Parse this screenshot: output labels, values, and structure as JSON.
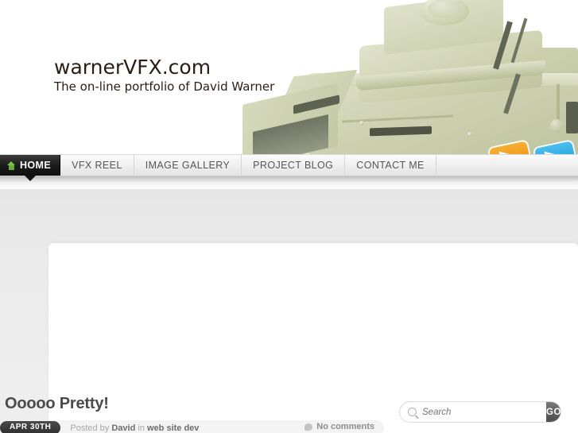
{
  "site": {
    "logo_title": "warnerVFX.com",
    "logo_subtitle": "The on-line portfolio of David Warner"
  },
  "header": {
    "artwork_name": "tank-3d-render",
    "artwork_color": "#ccd0b0",
    "chips": [
      {
        "name": "orange-chip",
        "color": "#ef8f13",
        "glyph": "▶"
      },
      {
        "name": "blue-chip",
        "color": "#1f9fd8",
        "glyph": "▶"
      }
    ]
  },
  "nav": {
    "items": [
      {
        "label": "HOME",
        "icon": "house-icon",
        "active": true
      },
      {
        "label": "VFX REEL",
        "active": false
      },
      {
        "label": "IMAGE GALLERY",
        "active": false
      },
      {
        "label": "PROJECT BLOG",
        "active": false
      },
      {
        "label": "CONTACT ME",
        "active": false
      }
    ],
    "active_bg": "#131313",
    "house_icon_color": "#7cc243"
  },
  "post": {
    "title": "Ooooo Pretty!",
    "date_badge": "APR 30TH",
    "posted_by_prefix": "Posted by",
    "author": "David",
    "in_word": "in",
    "category": "web site dev",
    "comments_label": "No comments"
  },
  "search": {
    "placeholder": "Search",
    "value": "",
    "button_label": "GO",
    "icon": "search-icon"
  },
  "colors": {
    "page_bg": "#ebebeb",
    "panel_bg": "#ffffff",
    "title_text": "#4a4a4a",
    "meta_text": "#a8a8a8",
    "accent_green": "#7cc243"
  }
}
